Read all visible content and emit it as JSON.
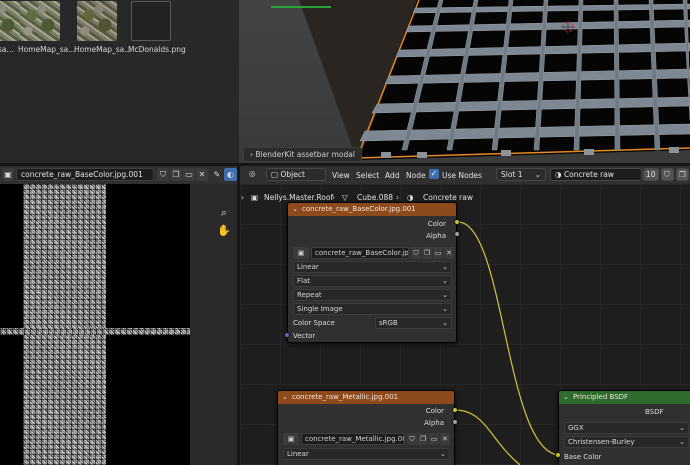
{
  "file_browser": {
    "items": [
      {
        "label": "sa..."
      },
      {
        "label": "HomeMap_sa..."
      },
      {
        "label": "HomeMap_sa..."
      },
      {
        "label": "McDonalds.png"
      }
    ]
  },
  "viewport": {
    "toast": "BlenderKit assetbar modal"
  },
  "image_editor": {
    "image_name": "concrete_raw_BaseColor.jpg.001"
  },
  "node_editor": {
    "header": {
      "mode": "Object",
      "menus": [
        "View",
        "Select",
        "Add",
        "Node"
      ],
      "use_nodes_label": "Use Nodes",
      "slot": "Slot 1",
      "material": "Concrete raw",
      "user_count": "10"
    },
    "breadcrumb": {
      "object": "Nellys.Master.Roof",
      "mesh": "Cube.088",
      "material": "Concrete raw"
    },
    "node_basecolor": {
      "title": "concrete_raw_BaseColor.jpg.001",
      "out_color": "Color",
      "out_alpha": "Alpha",
      "image_field": "concrete_raw_BaseColor.jpg...",
      "interpolation": "Linear",
      "projection": "Flat",
      "extension": "Repeat",
      "source": "Single Image",
      "color_space_label": "Color Space",
      "color_space": "sRGB",
      "in_vector": "Vector"
    },
    "node_metallic": {
      "title": "concrete_raw_Metallic.jpg.001",
      "out_color": "Color",
      "out_alpha": "Alpha",
      "image_field": "concrete_raw_Metallic.jpg.001",
      "interpolation": "Linear"
    },
    "node_bsdf": {
      "title": "Principled BSDF",
      "out_bsdf": "BSDF",
      "distribution": "GGX",
      "subsurface": "Christensen-Burley",
      "in_base_color": "Base Color"
    },
    "colors": {
      "image_node": "#8d4a1c",
      "shader_node": "#2f6b2c",
      "color_socket": "#c7c729",
      "link": "#d4c23a"
    }
  }
}
